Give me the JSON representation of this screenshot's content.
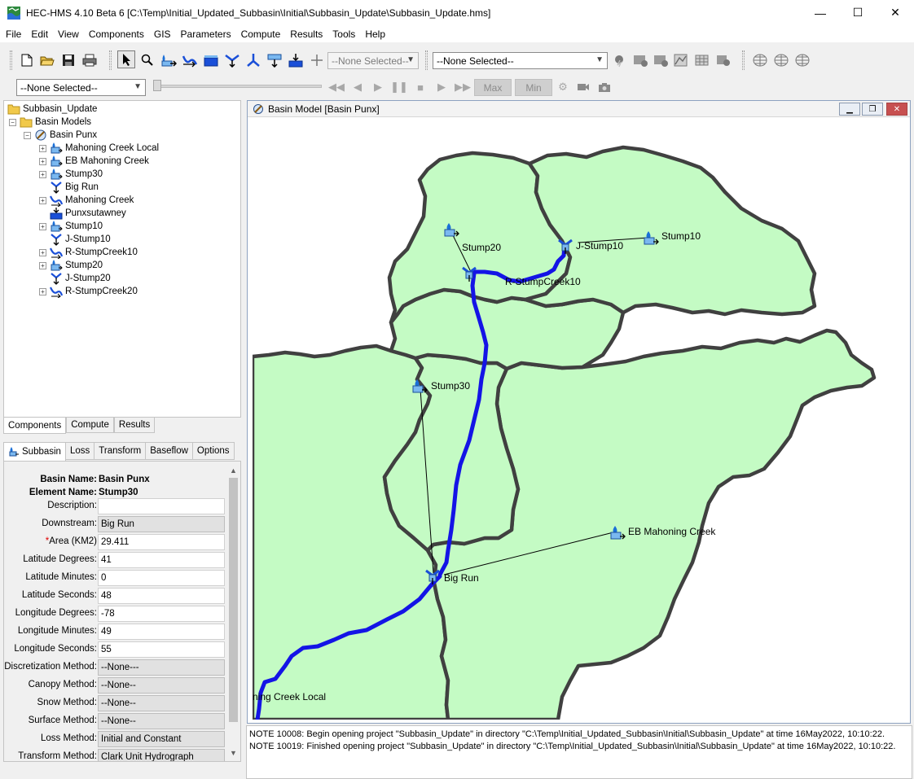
{
  "window": {
    "title": "HEC-HMS 4.10 Beta 6 [C:\\Temp\\Initial_Updated_Subbasin\\Initial\\Subbasin_Update\\Subbasin_Update.hms]",
    "minimize": "—",
    "maximize": "☐",
    "close": "✕"
  },
  "menu": [
    "File",
    "Edit",
    "View",
    "Components",
    "GIS",
    "Parameters",
    "Compute",
    "Results",
    "Tools",
    "Help"
  ],
  "toolbar": {
    "element_combo": "--None Selected--",
    "run_combo": "--None Selected--",
    "time_combo": "--None Selected--",
    "max_label": "Max",
    "min_label": "Min"
  },
  "tree": {
    "root": "Subbasin_Update",
    "basin_models": "Basin Models",
    "basin": "Basin Punx",
    "elements": [
      {
        "label": "Mahoning Creek Local",
        "icon": "subbasin-icon",
        "expandable": true
      },
      {
        "label": "EB Mahoning Creek",
        "icon": "subbasin-icon",
        "expandable": true
      },
      {
        "label": "Stump30",
        "icon": "subbasin-icon",
        "expandable": true
      },
      {
        "label": "Big Run",
        "icon": "junction-icon",
        "expandable": false
      },
      {
        "label": "Mahoning Creek",
        "icon": "reach-icon",
        "expandable": true
      },
      {
        "label": "Punxsutawney",
        "icon": "sink-icon",
        "expandable": false
      },
      {
        "label": "Stump10",
        "icon": "subbasin-icon",
        "expandable": true
      },
      {
        "label": "J-Stump10",
        "icon": "junction-icon",
        "expandable": false
      },
      {
        "label": "R-StumpCreek10",
        "icon": "reach-icon",
        "expandable": true
      },
      {
        "label": "Stump20",
        "icon": "subbasin-icon",
        "expandable": true
      },
      {
        "label": "J-Stump20",
        "icon": "junction-icon",
        "expandable": false
      },
      {
        "label": "R-StumpCreek20",
        "icon": "reach-icon",
        "expandable": true
      }
    ]
  },
  "panel_tabs": [
    "Components",
    "Compute",
    "Results"
  ],
  "editor_tabs": [
    "Subbasin",
    "Loss",
    "Transform",
    "Baseflow",
    "Options"
  ],
  "editor": {
    "basin_name_label": "Basin Name:",
    "basin_name": "Basin Punx",
    "element_name_label": "Element Name:",
    "element_name": "Stump30",
    "required_mark": "*",
    "fields": [
      {
        "label": "Description:",
        "value": "",
        "kind": "text"
      },
      {
        "label": "Downstream:",
        "value": "Big Run",
        "kind": "select"
      },
      {
        "label": "Area (KM2)",
        "value": "29.411",
        "kind": "text",
        "required": true
      },
      {
        "label": "Latitude Degrees:",
        "value": "41",
        "kind": "text"
      },
      {
        "label": "Latitude Minutes:",
        "value": "0",
        "kind": "text"
      },
      {
        "label": "Latitude Seconds:",
        "value": "48",
        "kind": "text"
      },
      {
        "label": "Longitude Degrees:",
        "value": "-78",
        "kind": "text"
      },
      {
        "label": "Longitude Minutes:",
        "value": "49",
        "kind": "text"
      },
      {
        "label": "Longitude Seconds:",
        "value": "55",
        "kind": "text"
      },
      {
        "label": "Discretization Method:",
        "value": "--None---",
        "kind": "select"
      },
      {
        "label": "Canopy Method:",
        "value": "--None--",
        "kind": "select"
      },
      {
        "label": "Snow Method:",
        "value": "--None--",
        "kind": "select"
      },
      {
        "label": "Surface Method:",
        "value": "--None--",
        "kind": "select"
      },
      {
        "label": "Loss Method:",
        "value": "Initial and Constant",
        "kind": "select"
      },
      {
        "label": "Transform Method:",
        "value": "Clark Unit Hydrograph",
        "kind": "select"
      }
    ]
  },
  "basin_window": {
    "title": "Basin Model [Basin Punx]",
    "labels": {
      "stump20": "Stump20",
      "jstump10": "J-Stump10",
      "stump10": "Stump10",
      "rstumpcreek10": "R-StumpCreek10",
      "stump30": "Stump30",
      "ebmahoning": "EB Mahoning Creek",
      "bigrun": "Big Run",
      "mahoninglocal": "ning Creek Local"
    }
  },
  "colors": {
    "subbasin_fill": "#c4fbc4",
    "boundary": "#404040",
    "river": "#1414e6"
  },
  "log": [
    "NOTE 10008:  Begin opening project \"Subbasin_Update\" in directory \"C:\\Temp\\Initial_Updated_Subbasin\\Initial\\Subbasin_Update\" at time 16May2022, 10:10:22.",
    "NOTE 10019:  Finished opening project \"Subbasin_Update\" in directory \"C:\\Temp\\Initial_Updated_Subbasin\\Initial\\Subbasin_Update\" at time 16May2022, 10:10:22."
  ]
}
